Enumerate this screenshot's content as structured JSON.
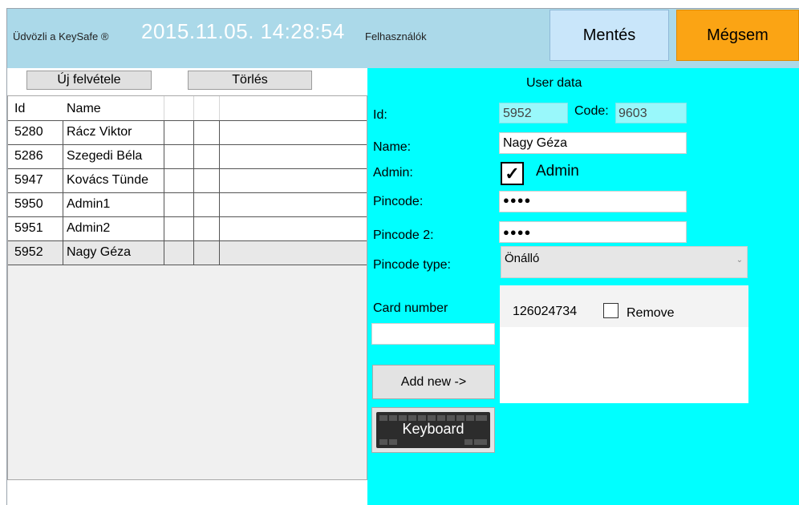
{
  "header": {
    "welcome": "Üdvözli a KeySafe ®",
    "datetime": "2015.11.05. 14:28:54",
    "section": "Felhasználók",
    "save_label": "Mentés",
    "cancel_label": "Mégsem"
  },
  "toolbar": {
    "new_label": "Új felvétele",
    "delete_label": "Törlés"
  },
  "grid": {
    "columns": [
      "Id",
      "Name"
    ],
    "rows": [
      {
        "id": "5280",
        "name": "Rácz Viktor"
      },
      {
        "id": "5286",
        "name": "Szegedi Béla"
      },
      {
        "id": "5947",
        "name": "Kovács Tünde"
      },
      {
        "id": "5950",
        "name": "Admin1"
      },
      {
        "id": "5951",
        "name": "Admin2"
      },
      {
        "id": "5952",
        "name": "Nagy Géza"
      }
    ]
  },
  "form": {
    "title": "User data",
    "id_label": "Id:",
    "id_value": "5952",
    "code_label": "Code:",
    "code_value": "9603",
    "name_label": "Name:",
    "name_value": "Nagy Géza",
    "admin_label": "Admin:",
    "admin_check_label": "Admin",
    "admin_checked": true,
    "pincode_label": "Pincode:",
    "pincode_value": "●●●●",
    "pincode2_label": "Pincode 2:",
    "pincode2_value": "●●●●",
    "pintype_label": "Pincode type:",
    "pintype_value": "Önálló",
    "card_label": "Card number",
    "card_value": "",
    "card_entry": "126024734",
    "remove_label": "Remove",
    "addnew_label": "Add new ->",
    "keyboard_label": "Keyboard"
  },
  "colors": {
    "header_bg": "#abd9e9",
    "save_bg": "#c9e6fa",
    "cancel_bg": "#fba414",
    "panel_bg": "#00ffff"
  }
}
